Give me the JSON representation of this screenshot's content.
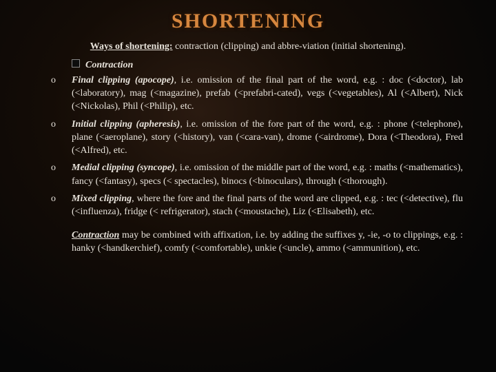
{
  "title": "SHORTENING",
  "lead": {
    "label": "Ways of shortening:",
    "rest": " contraction (clipping) and abbre-viation (initial shortening)."
  },
  "sub": "Contraction",
  "items": [
    {
      "term": "Final clipping (apocope)",
      "rest": ", i.e. omission of the final part of the word, e.g. : doc (<doctor), lab (<laboratory), mag (<magazine), prefab (<prefabri-cated), vegs (<vegetables), Al (<Albert), Nick (<Nickolas), Phil (<Philip), etc."
    },
    {
      "term": "Initial clipping (apheresis)",
      "rest": ", i.e. omission of the fore part of the word, e.g. : phone (<telephone), plane (<aeroplane), story (<history), van (<cara-van), drome (<airdrome), Dora (<Theodora), Fred (<Alfred), etc."
    },
    {
      "term": "Medial clipping (syncope)",
      "rest": ", i.e. omission of the middle part of the word, e.g. : maths (<mathematics), fancy (<fantasy), specs (< spectacles), binocs (<binoculars), through (<thorough)."
    },
    {
      "term": "Mixed clipping",
      "rest": ", where the fore and the final parts of the word are clipped, e.g. : tec (<detective), flu (<influenza), fridge (< refrigerator), stach (<moustache), Liz (<Elisabeth), etc."
    }
  ],
  "tail": {
    "term": "Contraction",
    "rest": " may be combined with affixation, i.e. by adding the suffixes y, -ie, -o to clippings, e.g. : hanky (<handkerchief), comfy (<comfortable), unkie (<uncle), ammo (<ammunition), etc."
  }
}
